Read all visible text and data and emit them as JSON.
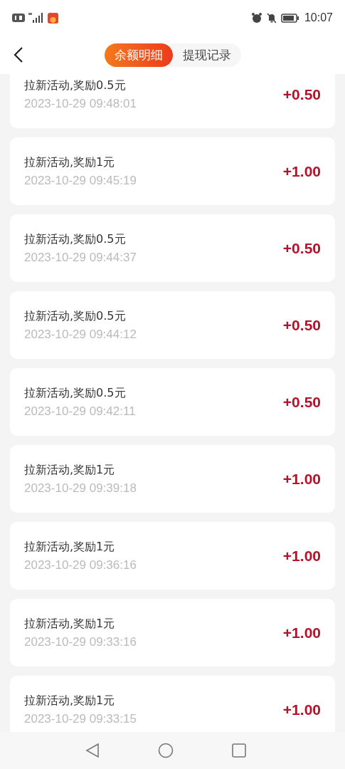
{
  "status_bar": {
    "time": "10:07"
  },
  "tabs": [
    {
      "label": "余额明细",
      "selected": true
    },
    {
      "label": "提现记录",
      "selected": false
    }
  ],
  "records": [
    {
      "title": "拉新活动,奖励0.5元",
      "time": "2023-10-29 09:48:01",
      "amount": "+0.50"
    },
    {
      "title": "拉新活动,奖励1元",
      "time": "2023-10-29 09:45:19",
      "amount": "+1.00"
    },
    {
      "title": "拉新活动,奖励0.5元",
      "time": "2023-10-29 09:44:37",
      "amount": "+0.50"
    },
    {
      "title": "拉新活动,奖励0.5元",
      "time": "2023-10-29 09:44:12",
      "amount": "+0.50"
    },
    {
      "title": "拉新活动,奖励0.5元",
      "time": "2023-10-29 09:42:11",
      "amount": "+0.50"
    },
    {
      "title": "拉新活动,奖励1元",
      "time": "2023-10-29 09:39:18",
      "amount": "+1.00"
    },
    {
      "title": "拉新活动,奖励1元",
      "time": "2023-10-29 09:36:16",
      "amount": "+1.00"
    },
    {
      "title": "拉新活动,奖励1元",
      "time": "2023-10-29 09:33:16",
      "amount": "+1.00"
    },
    {
      "title": "拉新活动,奖励1元",
      "time": "2023-10-29 09:33:15",
      "amount": "+1.00"
    }
  ]
}
